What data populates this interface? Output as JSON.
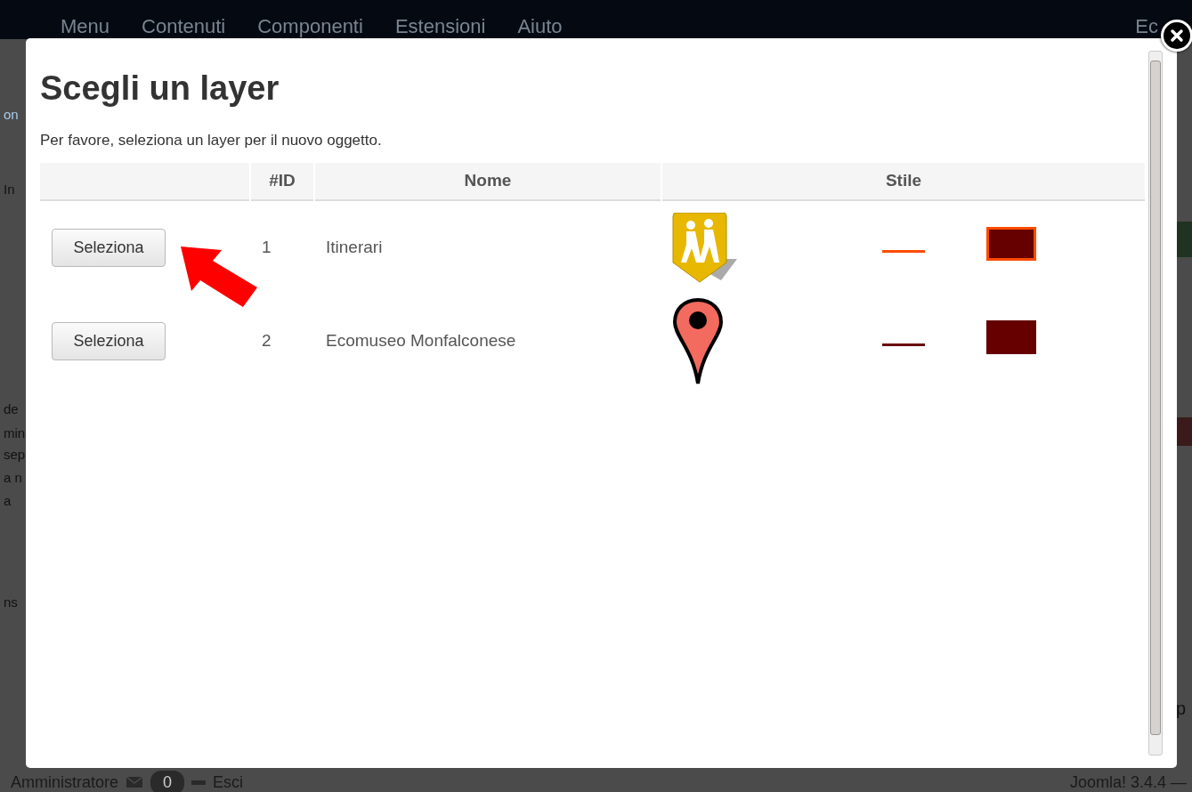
{
  "background": {
    "menu": [
      "Menu",
      "Contenuti",
      "Componenti",
      "Estensioni",
      "Aiuto"
    ],
    "menu_right": "Ec",
    "side_fragments": [
      {
        "text": "on",
        "kind": "link"
      },
      {
        "text": "In",
        "kind": "text"
      },
      {
        "text": "de",
        "kind": "text"
      },
      {
        "text": "min",
        "kind": "text"
      },
      {
        "text": "sep",
        "kind": "text"
      },
      {
        "text": "a n",
        "kind": "text"
      },
      {
        "text": "a",
        "kind": "text"
      },
      {
        "text": "ns",
        "kind": "text"
      }
    ],
    "right_fragment": "p",
    "footer": {
      "user": "Amministratore",
      "messages": "0",
      "logout": "Esci",
      "version": "Joomla! 3.4.4 —"
    }
  },
  "modal": {
    "title": "Scegli un layer",
    "intro": "Per favore, seleziona un layer per il nuovo oggetto.",
    "columns": [
      "#ID",
      "Nome",
      "Stile"
    ],
    "rows": [
      {
        "action": "Seleziona",
        "id": "1",
        "name": "Itinerari",
        "icon": {
          "kind": "hikers"
        },
        "line": {
          "color": "#ff4a00"
        },
        "polygon": {
          "color": "#660000",
          "outline": {
            "color": "#ff4a00"
          }
        }
      },
      {
        "action": "Seleziona",
        "id": "2",
        "name": "Ecomuseo Monfalconese",
        "icon": {
          "kind": "pin"
        },
        "line": {
          "color": "#660000"
        },
        "polygon": {
          "color": "#660000"
        }
      }
    ]
  }
}
